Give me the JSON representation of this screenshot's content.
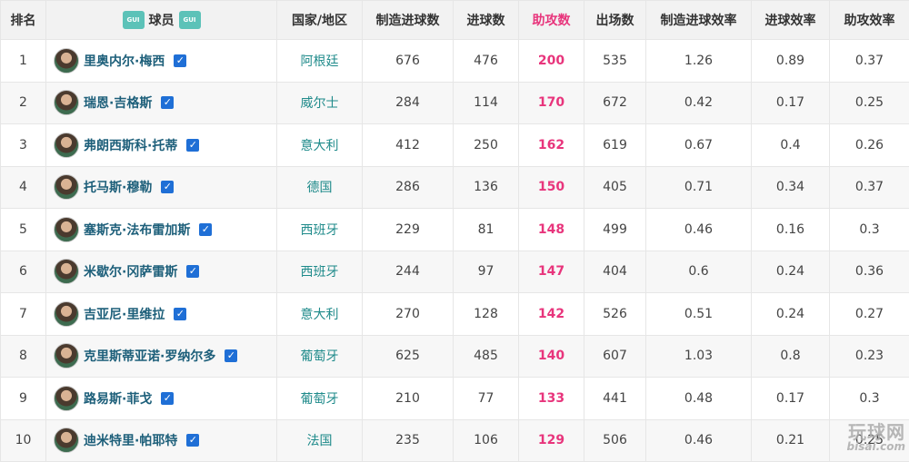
{
  "columns": {
    "rank": "排名",
    "player": "球员",
    "nation": "国家/地区",
    "created_goals": "制造进球数",
    "goals": "进球数",
    "assists": "助攻数",
    "apps": "出场数",
    "created_eff": "制造进球效率",
    "goal_eff": "进球效率",
    "assist_eff": "助攻效率"
  },
  "header_logo_text": "GUI",
  "colors": {
    "highlight": "#e8357c",
    "nation": "#1e8a8a",
    "player": "#1d5f7a",
    "check": "#1f6fd6"
  },
  "rows": [
    {
      "rank": "1",
      "name": "里奥内尔·梅西",
      "nation": "阿根廷",
      "created": "676",
      "goals": "476",
      "assists": "200",
      "apps": "535",
      "ce": "1.26",
      "ge": "0.89",
      "ae": "0.37"
    },
    {
      "rank": "2",
      "name": "瑞恩·吉格斯",
      "nation": "威尔士",
      "created": "284",
      "goals": "114",
      "assists": "170",
      "apps": "672",
      "ce": "0.42",
      "ge": "0.17",
      "ae": "0.25"
    },
    {
      "rank": "3",
      "name": "弗朗西斯科·托蒂",
      "nation": "意大利",
      "created": "412",
      "goals": "250",
      "assists": "162",
      "apps": "619",
      "ce": "0.67",
      "ge": "0.4",
      "ae": "0.26"
    },
    {
      "rank": "4",
      "name": "托马斯·穆勒",
      "nation": "德国",
      "created": "286",
      "goals": "136",
      "assists": "150",
      "apps": "405",
      "ce": "0.71",
      "ge": "0.34",
      "ae": "0.37"
    },
    {
      "rank": "5",
      "name": "塞斯克·法布雷加斯",
      "nation": "西班牙",
      "created": "229",
      "goals": "81",
      "assists": "148",
      "apps": "499",
      "ce": "0.46",
      "ge": "0.16",
      "ae": "0.3"
    },
    {
      "rank": "6",
      "name": "米歇尔·冈萨雷斯",
      "nation": "西班牙",
      "created": "244",
      "goals": "97",
      "assists": "147",
      "apps": "404",
      "ce": "0.6",
      "ge": "0.24",
      "ae": "0.36"
    },
    {
      "rank": "7",
      "name": "吉亚尼·里维拉",
      "nation": "意大利",
      "created": "270",
      "goals": "128",
      "assists": "142",
      "apps": "526",
      "ce": "0.51",
      "ge": "0.24",
      "ae": "0.27"
    },
    {
      "rank": "8",
      "name": "克里斯蒂亚诺·罗纳尔多",
      "nation": "葡萄牙",
      "created": "625",
      "goals": "485",
      "assists": "140",
      "apps": "607",
      "ce": "1.03",
      "ge": "0.8",
      "ae": "0.23"
    },
    {
      "rank": "9",
      "name": "路易斯·菲戈",
      "nation": "葡萄牙",
      "created": "210",
      "goals": "77",
      "assists": "133",
      "apps": "441",
      "ce": "0.48",
      "ge": "0.17",
      "ae": "0.3"
    },
    {
      "rank": "10",
      "name": "迪米特里·帕耶特",
      "nation": "法国",
      "created": "235",
      "goals": "106",
      "assists": "129",
      "apps": "506",
      "ce": "0.46",
      "ge": "0.21",
      "ae": "0.25"
    }
  ],
  "watermark": {
    "cn": "玩球网",
    "en": "bisai.com"
  }
}
